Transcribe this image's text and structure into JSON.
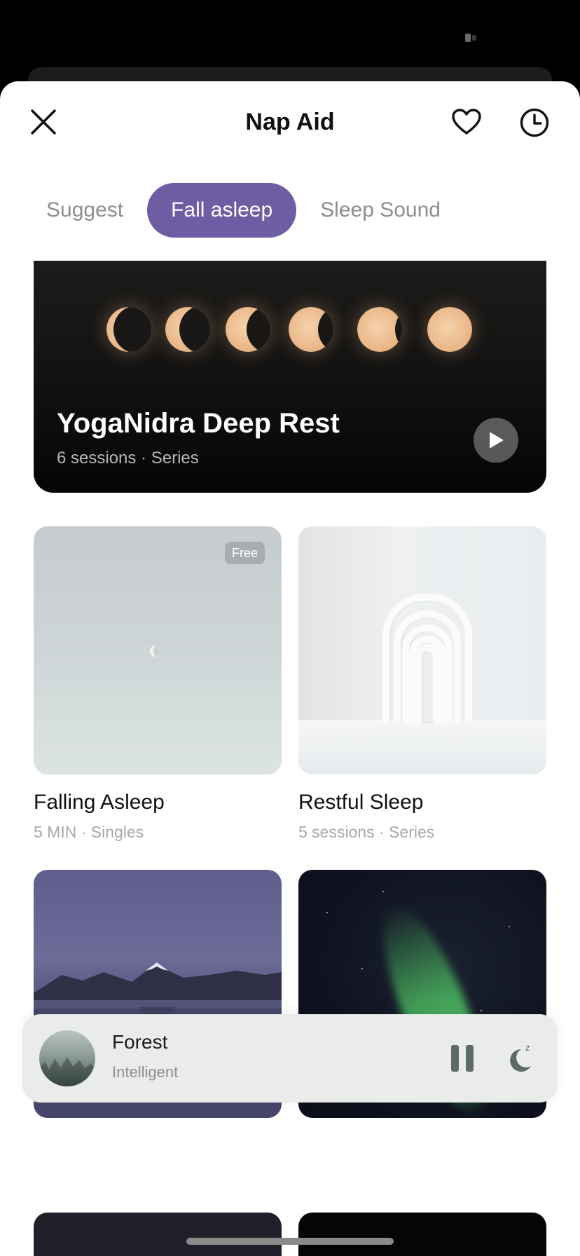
{
  "header": {
    "title": "Nap Aid",
    "close_icon": "close-icon",
    "favorite_icon": "heart-icon",
    "history_icon": "clock-icon"
  },
  "tabs": [
    {
      "label": "Suggest",
      "active": false
    },
    {
      "label": "Fall asleep",
      "active": true
    },
    {
      "label": "Sleep Sound",
      "active": false
    }
  ],
  "accent_color": "#6f5da3",
  "featured": {
    "title": "YogaNidra Deep Rest",
    "subtitle": "6 sessions · Series"
  },
  "cards": [
    {
      "title": "Falling Asleep",
      "subtitle": "5 MIN · Singles",
      "badge": "Free"
    },
    {
      "title": "Restful Sleep",
      "subtitle": "5 sessions · Series"
    }
  ],
  "player": {
    "title": "Forest",
    "subtitle": "Intelligent",
    "state": "playing"
  }
}
